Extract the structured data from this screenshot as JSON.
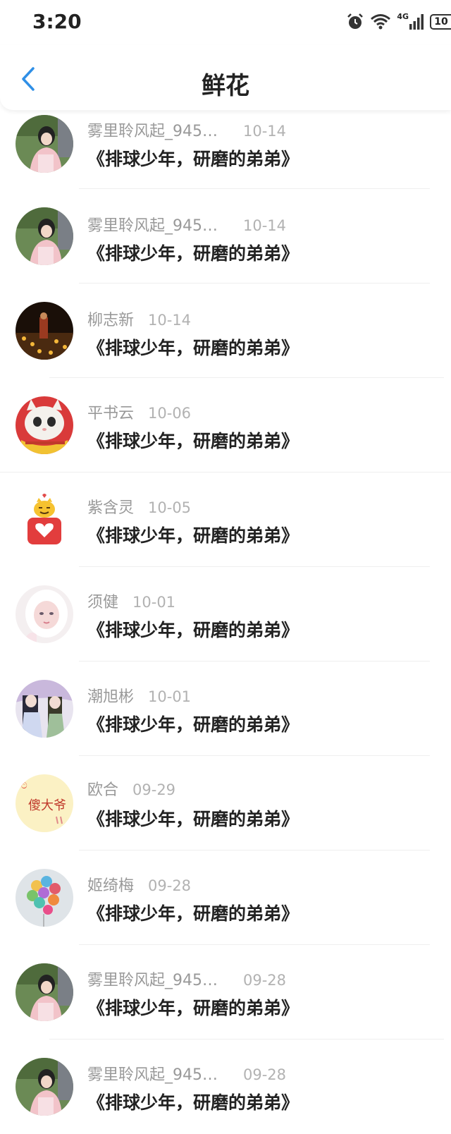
{
  "status_bar": {
    "time": "3:20",
    "network": "4G",
    "battery": "10"
  },
  "header": {
    "title": "鲜花"
  },
  "rows": [
    {
      "name": "雾里聆风起_945…",
      "date": "10-14",
      "content": "《排球少年，研磨的弟弟》",
      "avatar": "avatar-girl-pink-coat"
    },
    {
      "name": "雾里聆风起_945…",
      "date": "10-14",
      "content": "《排球少年，研磨的弟弟》",
      "avatar": "avatar-girl-pink-coat"
    },
    {
      "name": "柳志新",
      "date": "10-14",
      "content": "《排球少年，研磨的弟弟》",
      "avatar": "avatar-monk-candles"
    },
    {
      "name": "平书云",
      "date": "10-06",
      "content": "《排球少年，研磨的弟弟》",
      "avatar": "avatar-cat-scarf"
    },
    {
      "name": "紫含灵",
      "date": "10-05",
      "content": "《排球少年，研磨的弟弟》",
      "avatar": "avatar-cartoon-heart"
    },
    {
      "name": "须健",
      "date": "10-01",
      "content": "《排球少年，研磨的弟弟》",
      "avatar": "avatar-girl-white-hood"
    },
    {
      "name": "潮旭彬",
      "date": "10-01",
      "content": "《排球少年，研磨的弟弟》",
      "avatar": "avatar-anime-couple"
    },
    {
      "name": "欧合",
      "date": "09-29",
      "content": "《排球少年，研磨的弟弟》",
      "avatar": "avatar-text-sticker"
    },
    {
      "name": "姬绮梅",
      "date": "09-28",
      "content": "《排球少年，研磨的弟弟》",
      "avatar": "avatar-balloons"
    },
    {
      "name": "雾里聆风起_945…",
      "date": "09-28",
      "content": "《排球少年，研磨的弟弟》",
      "avatar": "avatar-girl-pink-coat"
    },
    {
      "name": "雾里聆风起_945…",
      "date": "09-28",
      "content": "《排球少年，研磨的弟弟》",
      "avatar": "avatar-girl-pink-coat"
    }
  ],
  "avatar_sticker_text": "傻大爷",
  "colors": {
    "accent": "#2f8fe6",
    "name_gray": "#999999",
    "date_gray": "#b2b2b2"
  }
}
